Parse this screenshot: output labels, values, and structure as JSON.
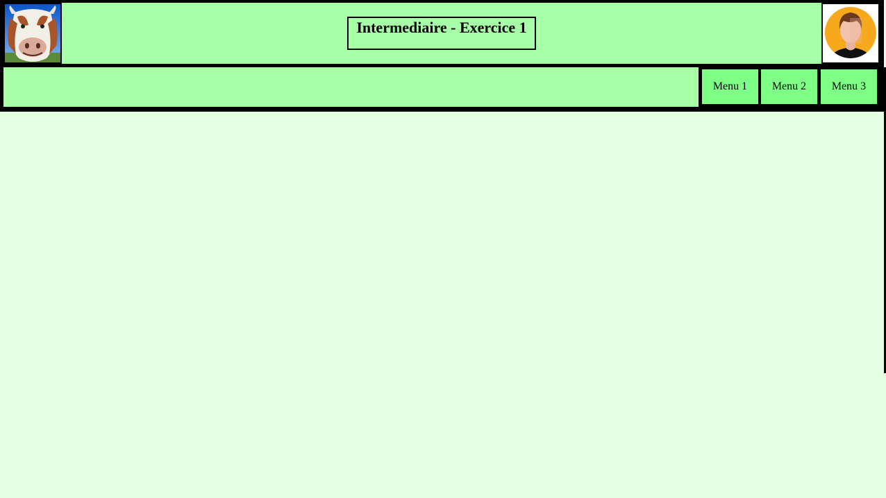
{
  "header": {
    "title": "Intermediaire - Exercice 1",
    "logo_icon": "cow-photo-icon",
    "avatar_icon": "user-avatar-icon"
  },
  "nav": {
    "items": [
      {
        "label": "Menu 1"
      },
      {
        "label": "Menu 2"
      },
      {
        "label": "Menu 3"
      }
    ]
  },
  "colors": {
    "page_background": "#e5ffe3",
    "header_background": "#a6ffa6",
    "menu_background": "#7eff85",
    "frame": "#000000",
    "avatar_circle": "#f7a91d"
  }
}
